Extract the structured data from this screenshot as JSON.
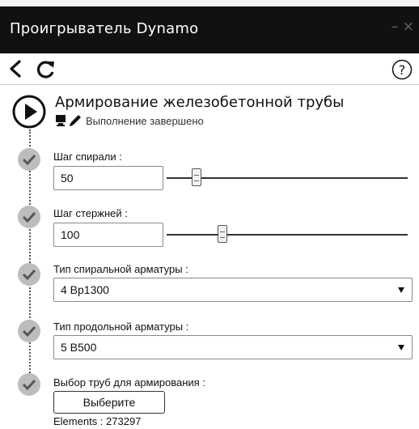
{
  "window": {
    "title": "Проигрыватель Dynamo",
    "controls": "– ×"
  },
  "toolbar": {
    "back_icon": "chevron-left-icon",
    "refresh_icon": "refresh-icon",
    "help_icon": "help-circle-icon"
  },
  "graph": {
    "title": "Армирование железобетонной трубы",
    "status": "Выполнение завершено",
    "play_icon": "play-circle-icon"
  },
  "inputs": {
    "spiral_step": {
      "label": "Шаг спирали :",
      "value": "50",
      "slider_fraction": 0.11
    },
    "rod_step": {
      "label": "Шаг стержней :",
      "value": "100",
      "slider_fraction": 0.22
    },
    "spiral_rebar_type": {
      "label": "Тип спиральной арматуры :",
      "selected": "4 Вр1300"
    },
    "longitudinal_rebar_type": {
      "label": "Тип продольной арматуры :",
      "selected": "5 В500"
    },
    "pipe_selection": {
      "label": "Выбор труб для армирования :",
      "button_label": "Выберите",
      "elements_text": "Elements : 273297"
    }
  },
  "colors": {
    "titlebar_bg": "#111111",
    "check_circle": "#bdbdbd"
  }
}
